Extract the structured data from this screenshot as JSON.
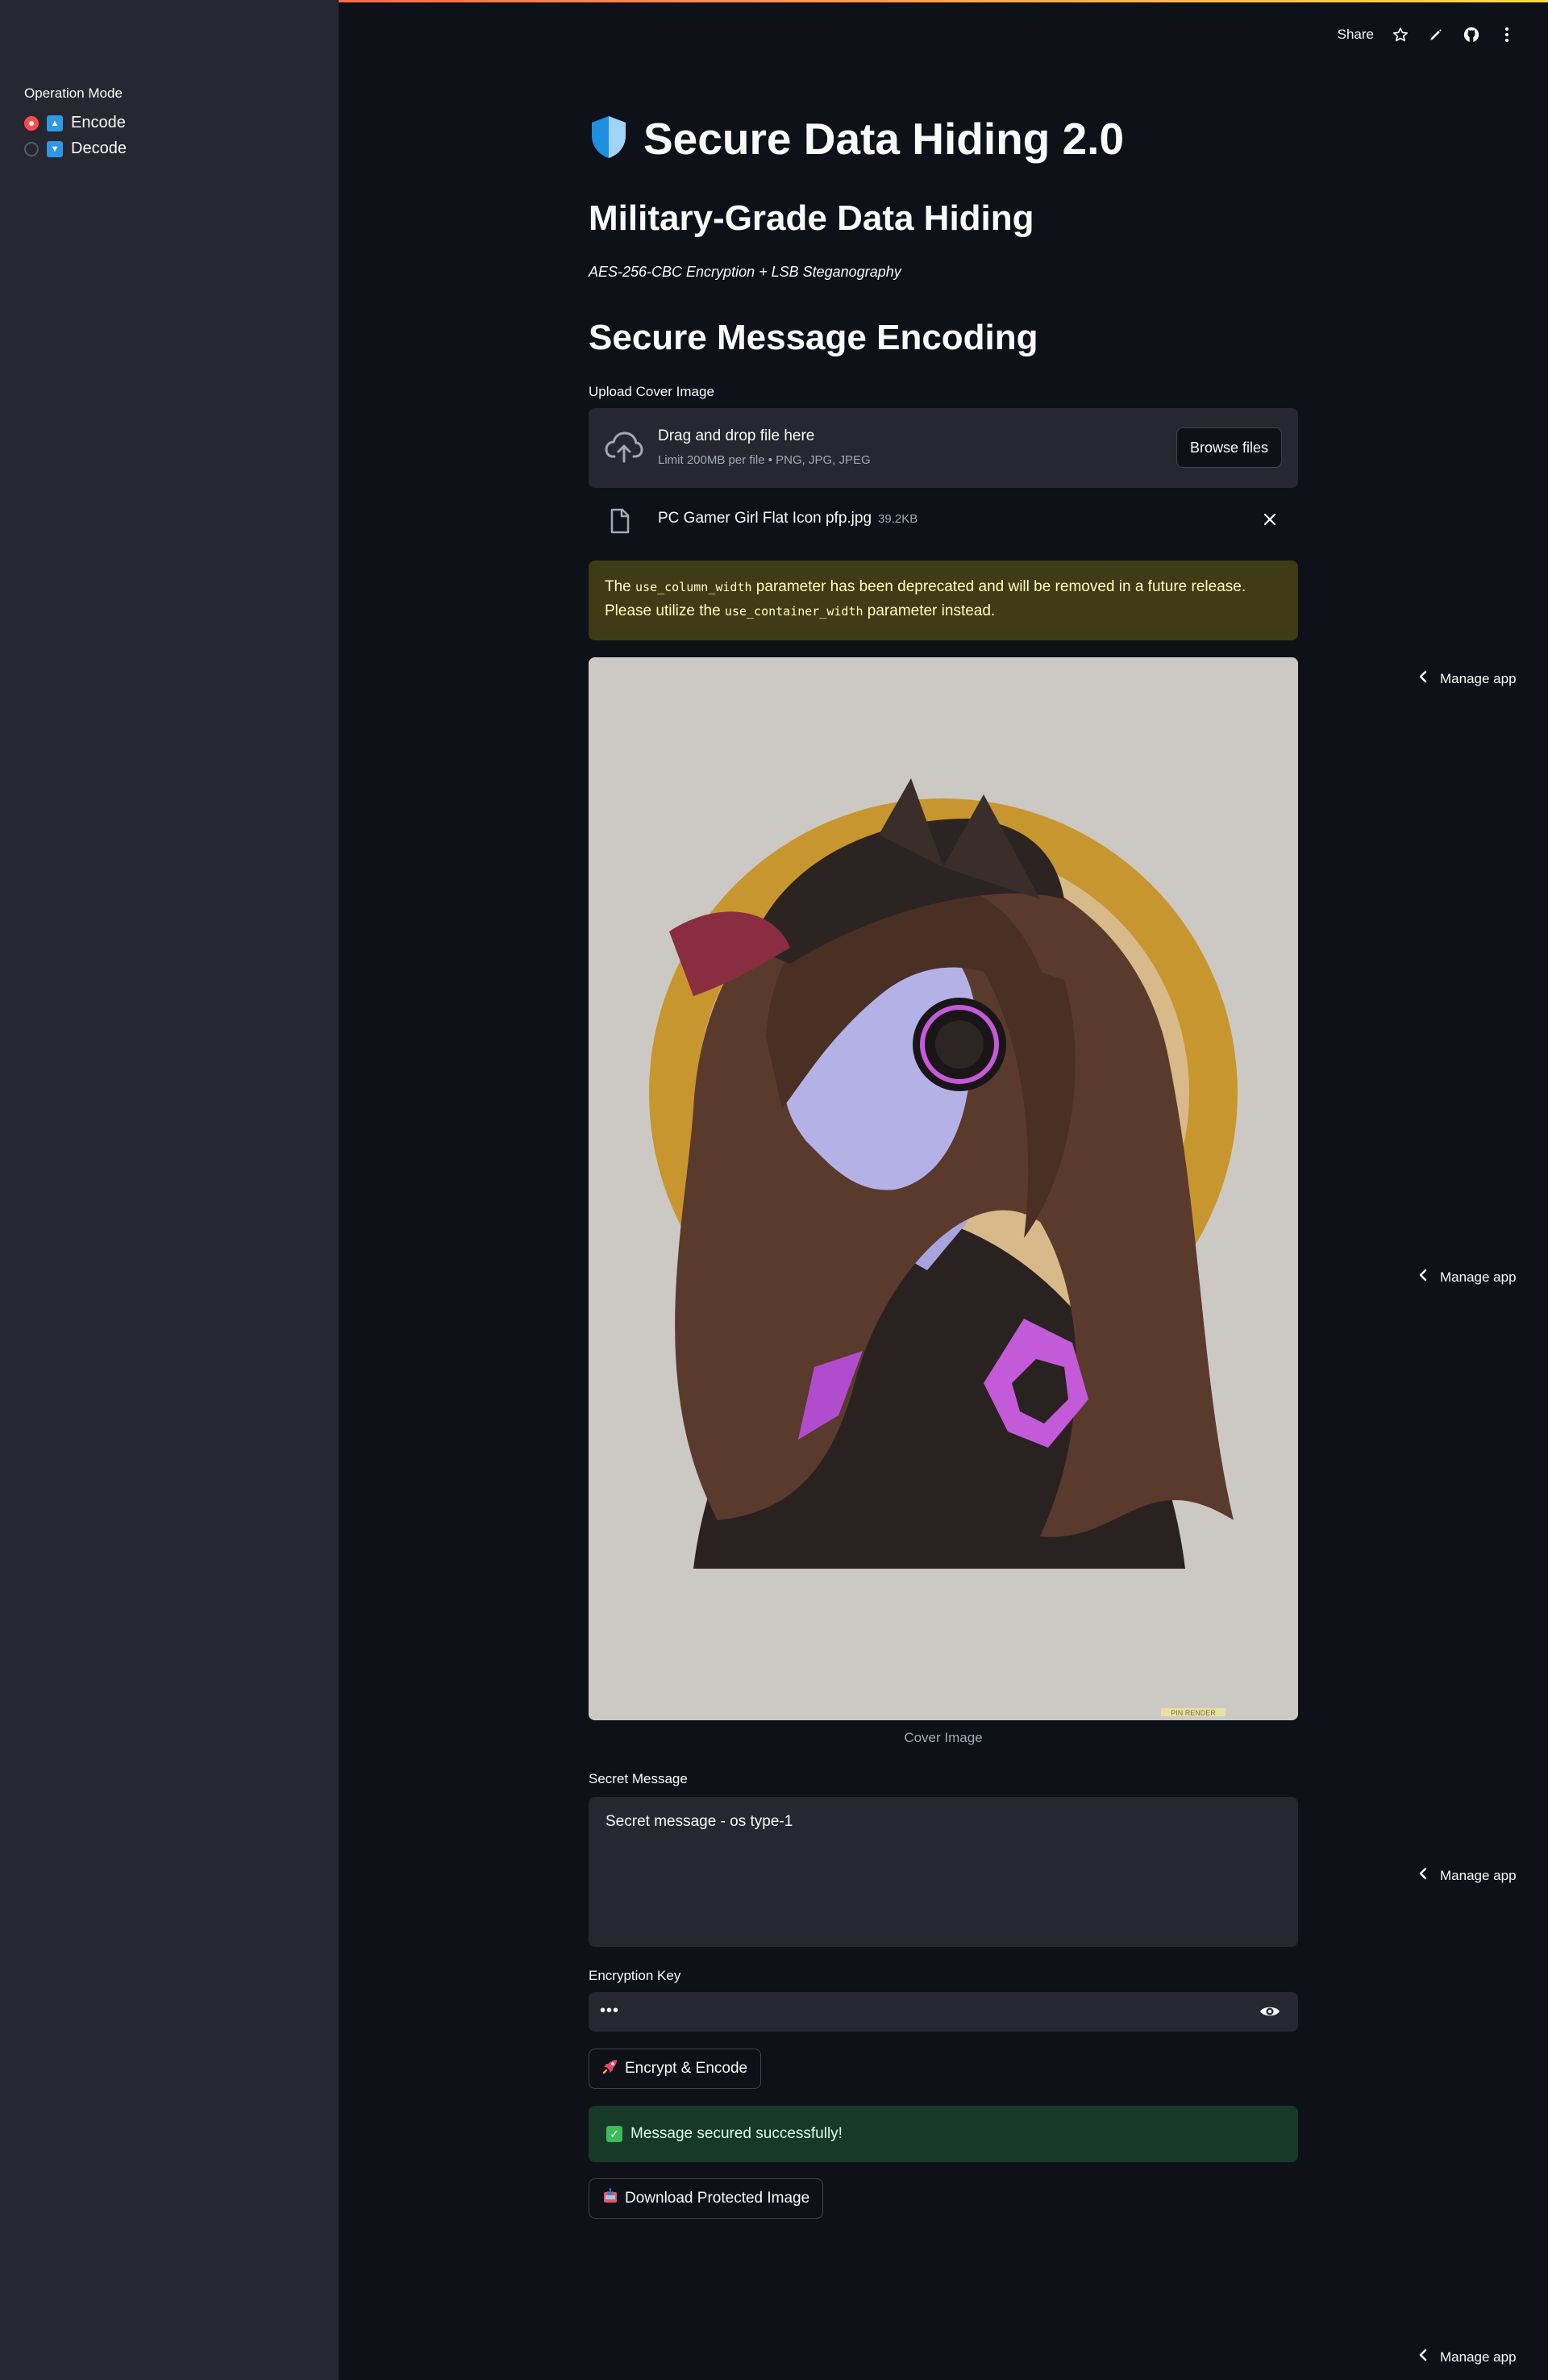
{
  "sidebar": {
    "radio_title": "Operation Mode",
    "options": [
      {
        "label": "Encode",
        "selected": true,
        "emoji": "up-arrow-emoji"
      },
      {
        "label": "Decode",
        "selected": false,
        "emoji": "down-arrow-emoji"
      }
    ]
  },
  "header": {
    "share_label": "Share",
    "icons": [
      "star-icon",
      "pencil-icon",
      "github-icon",
      "more-vertical-icon"
    ]
  },
  "main": {
    "title": "Secure Data Hiding 2.0",
    "title_icon": "shield-icon",
    "subtitle": "Military-Grade Data Hiding",
    "caption": "AES-256-CBC Encryption + LSB Steganography",
    "section_title": "Secure Message Encoding",
    "upload": {
      "label": "Upload Cover Image",
      "drop_text": "Drag and drop file here",
      "limit_text": "Limit 200MB per file • PNG, JPG, JPEG",
      "browse_label": "Browse files",
      "file_name": "PC Gamer Girl Flat Icon pfp.jpg",
      "file_size": "39.2KB"
    },
    "warning": {
      "part1": "The ",
      "code1": "use_column_width",
      "part2": " parameter has been deprecated and will be removed in a future release. Please utilize the ",
      "code2": "use_container_width",
      "part3": " parameter instead."
    },
    "image_caption": "Cover Image",
    "image_watermark": "PIN RENDER",
    "secret": {
      "label": "Secret Message",
      "value": "Secret message  - os type-1"
    },
    "key": {
      "label": "Encryption Key",
      "value": "•••"
    },
    "encrypt_button": "Encrypt & Encode",
    "success_text": "Message secured successfully!",
    "download_button": "Download Protected Image"
  },
  "manage_app_label": "Manage app",
  "colors": {
    "background": "#0e1117",
    "sidebar": "#262730",
    "accent": "#ff4b4b",
    "warning_bg": "#3e3b16",
    "success_bg": "#173928"
  }
}
